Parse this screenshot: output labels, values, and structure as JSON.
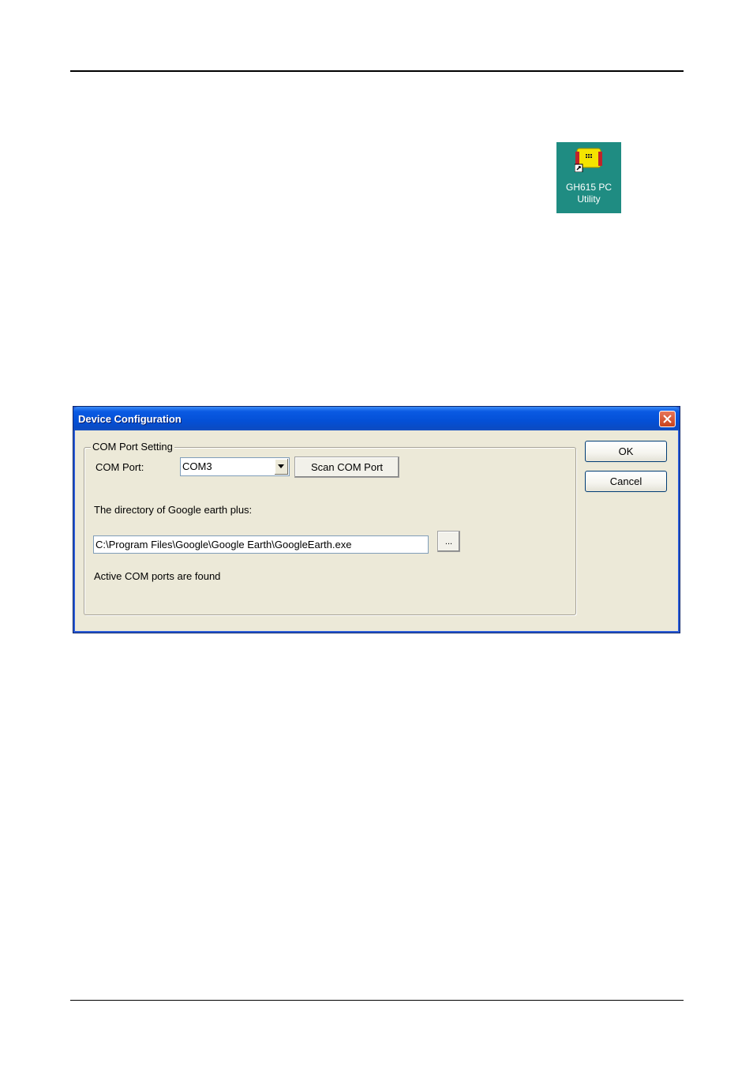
{
  "desktop_icon": {
    "label_line1": "GH615 PC",
    "label_line2": "Utility",
    "background_color": "#1f8c82",
    "icon": "gps-device-shortcut-icon"
  },
  "dialog": {
    "title": "Device Configuration",
    "close_icon": "close-icon",
    "group_title": "COM Port Setting",
    "com_port_label": "COM Port:",
    "com_port_value": "COM3",
    "scan_button": "Scan COM Port",
    "directory_label": "The directory of Google earth plus:",
    "directory_value": "C:\\Program Files\\Google\\Google Earth\\GoogleEarth.exe",
    "browse_button": "...",
    "status_text": "Active COM ports are found",
    "ok_button": "OK",
    "cancel_button": "Cancel",
    "title_bar_color": "#0450d6",
    "window_color": "#ece9d8"
  }
}
